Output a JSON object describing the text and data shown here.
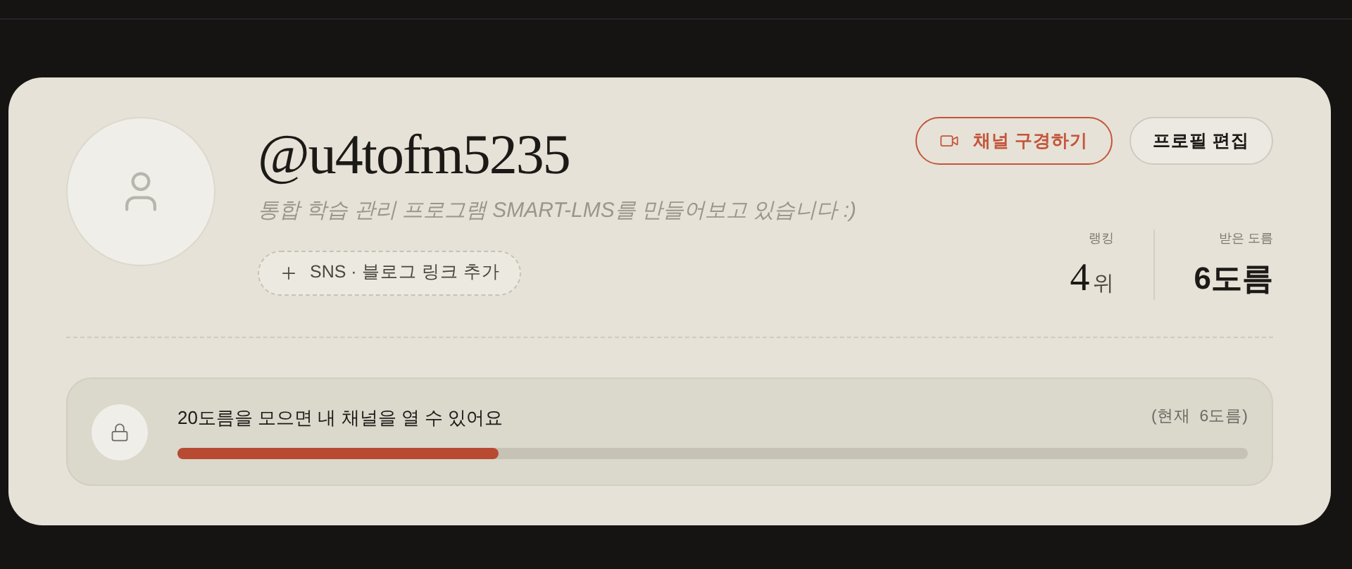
{
  "profile": {
    "handle": "@u4tofm5235",
    "bio": "통합 학습 관리 프로그램 SMART-LMS를 만들어보고 있습니다 :)",
    "add_link": "SNS · 블로그 링크 추가"
  },
  "buttons": [
    {
      "label": "채널 구경하기",
      "kind": "primary"
    },
    {
      "label": "프로필 편집",
      "kind": "secondary"
    }
  ],
  "stats": {
    "rank_label": "랭킹",
    "rank_value": "4",
    "rank_unit": "위",
    "received_label": "받은 도름",
    "received_value": "6도름"
  },
  "progress": {
    "message": "20도름을 모으면 내 채널을 열 수 있어요",
    "current": "(현재  6도름)",
    "level": 0.3
  }
}
